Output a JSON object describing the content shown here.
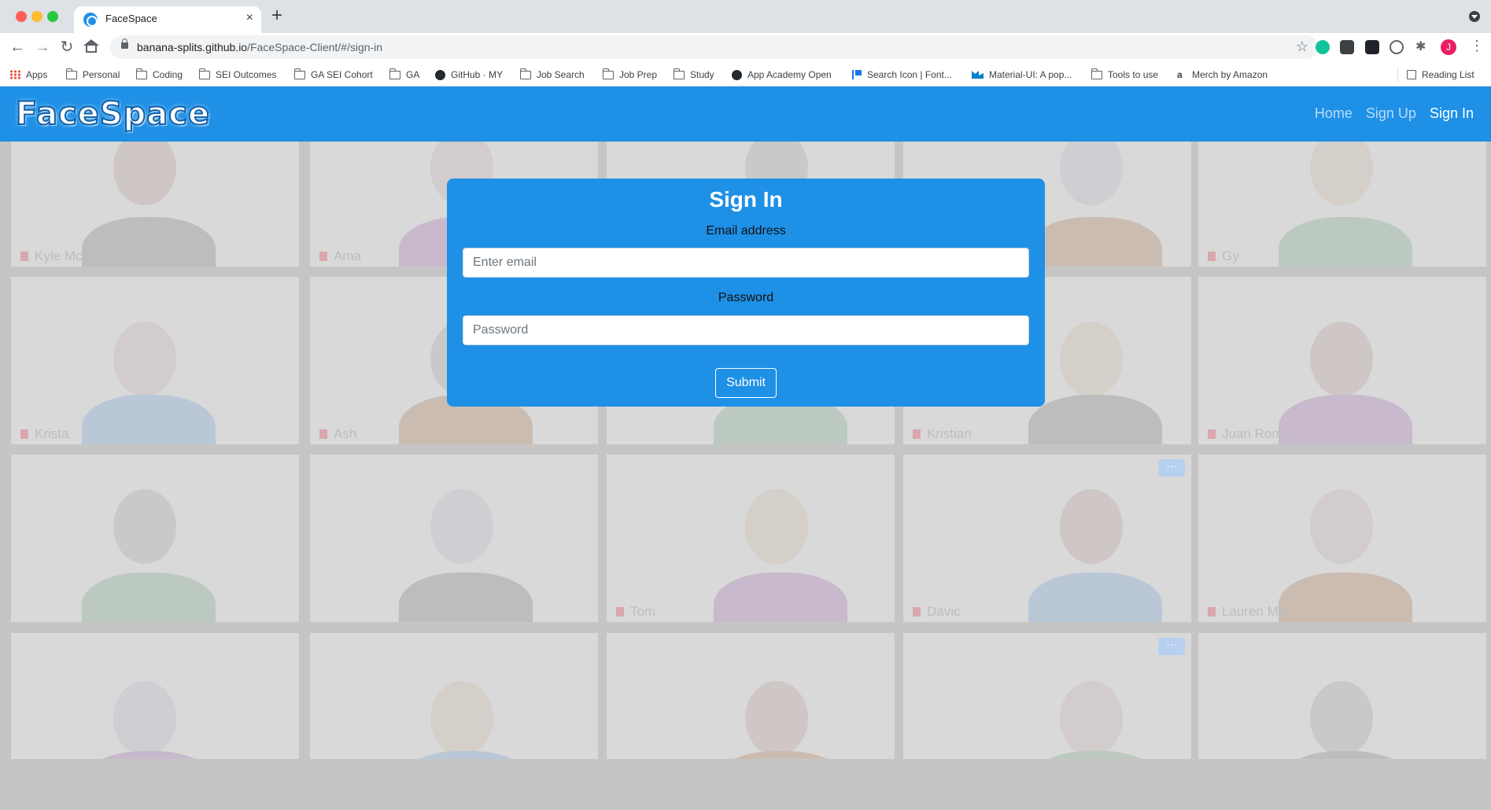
{
  "browser": {
    "tab_title": "FaceSpace",
    "tab_close": "×",
    "new_tab": "+",
    "url_host": "banana-splits.github.io",
    "url_path": "/FaceSpace-Client/#/sign-in",
    "avatar_initial": "J",
    "bookmarks": [
      {
        "label": "Apps",
        "icon": "apps-grid-icon"
      },
      {
        "label": "Personal",
        "icon": "folder-icon"
      },
      {
        "label": "Coding",
        "icon": "folder-icon"
      },
      {
        "label": "SEI Outcomes",
        "icon": "folder-icon"
      },
      {
        "label": "GA SEI Cohort",
        "icon": "folder-icon"
      },
      {
        "label": "GA",
        "icon": "folder-icon"
      },
      {
        "label": "GitHub · MY",
        "icon": "github-icon"
      },
      {
        "label": "Job Search",
        "icon": "folder-icon"
      },
      {
        "label": "Job Prep",
        "icon": "folder-icon"
      },
      {
        "label": "Study",
        "icon": "folder-icon"
      },
      {
        "label": "App Academy Open",
        "icon": "globe-icon"
      },
      {
        "label": "Search Icon | Font...",
        "icon": "flag-icon"
      },
      {
        "label": "Material-UI: A pop...",
        "icon": "material-ui-icon"
      },
      {
        "label": "Tools to use",
        "icon": "folder-icon"
      },
      {
        "label": "Merch by Amazon",
        "icon": "amazon-icon"
      }
    ],
    "reading_list": "Reading List"
  },
  "navbar": {
    "brand": "FaceSpace",
    "links": [
      {
        "label": "Home",
        "active": false
      },
      {
        "label": "Sign Up",
        "active": false
      },
      {
        "label": "Sign In",
        "active": true
      }
    ]
  },
  "signin": {
    "title": "Sign In",
    "email_label": "Email address",
    "email_placeholder": "Enter email",
    "password_label": "Password",
    "password_placeholder": "Password",
    "submit_label": "Submit"
  },
  "background_tiles": {
    "names": [
      "Kyle McCorkle Wakefield",
      "Ama",
      "",
      "",
      "Gy",
      "Krista",
      "Ash",
      "",
      "Kristian",
      "Juan Roms",
      "",
      "",
      "Tom",
      "Davic",
      "Lauren Mei",
      "",
      "",
      "",
      "",
      ""
    ],
    "more_button": "···"
  },
  "colors": {
    "brand_blue": "#1e90e6",
    "navbar_link_inactive": "#bcdcf7",
    "overlay_gray": "#c5c5c5"
  }
}
